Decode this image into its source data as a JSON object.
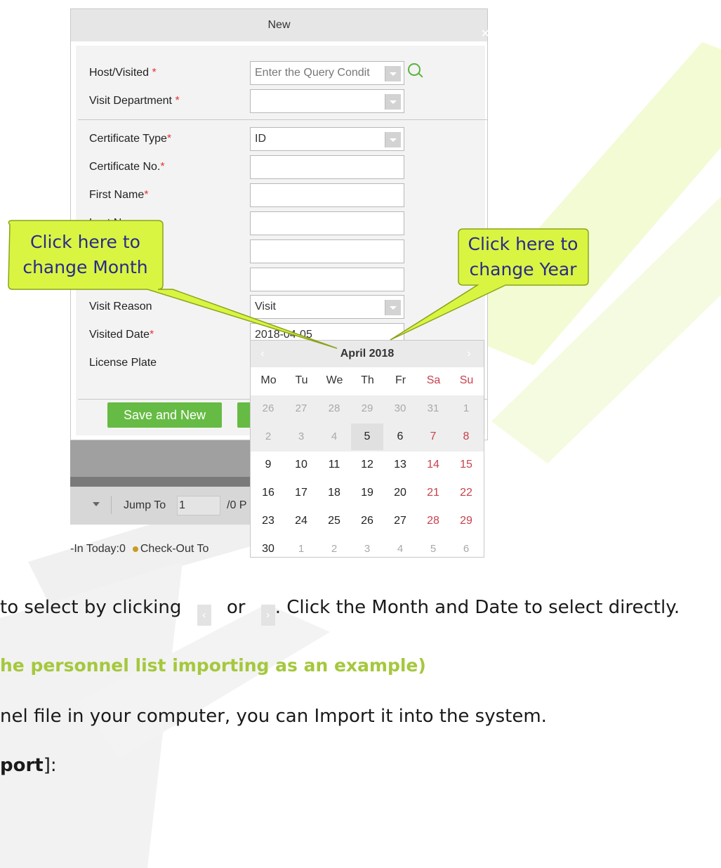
{
  "dialog": {
    "title": "New",
    "close_icon": "close-icon",
    "fields": [
      {
        "label": "Host/Visited",
        "required": true,
        "value": "Enter the Query Condit",
        "type": "combo-search"
      },
      {
        "label": "Visit Department",
        "required": true,
        "value": "",
        "type": "select"
      },
      {
        "label": "Certificate Type",
        "required": true,
        "value": "ID",
        "type": "select"
      },
      {
        "label": "Certificate No.",
        "required": true,
        "value": "",
        "type": "text"
      },
      {
        "label": "First Name",
        "required": true,
        "value": "",
        "type": "text"
      },
      {
        "label": "Last Name",
        "required": false,
        "value": "",
        "type": "text"
      },
      {
        "label": "",
        "required": false,
        "value": "",
        "type": "text"
      },
      {
        "label": "",
        "required": false,
        "value": "",
        "type": "text"
      },
      {
        "label": "Visit Reason",
        "required": false,
        "value": "Visit",
        "type": "select"
      },
      {
        "label": "Visited Date",
        "required": true,
        "value": "2018-04-05",
        "type": "date"
      },
      {
        "label": "License Plate",
        "required": false,
        "value": "",
        "type": "text"
      }
    ],
    "save_new_label": "Save and New",
    "required_mark": "*"
  },
  "background_grid": {
    "jump_label": "Jump To",
    "jump_value": "1",
    "pages_text": "/0 P",
    "status_in": "-In Today:0",
    "status_out": "Check-Out To"
  },
  "calendar": {
    "title": "April 2018",
    "weekdays": [
      "Mo",
      "Tu",
      "We",
      "Th",
      "Fr",
      "Sa",
      "Su"
    ],
    "weeks": [
      [
        "26",
        "27",
        "28",
        "29",
        "30",
        "31",
        "1"
      ],
      [
        "2",
        "3",
        "4",
        "5",
        "6",
        "7",
        "8"
      ],
      [
        "9",
        "10",
        "11",
        "12",
        "13",
        "14",
        "15"
      ],
      [
        "16",
        "17",
        "18",
        "19",
        "20",
        "21",
        "22"
      ],
      [
        "23",
        "24",
        "25",
        "26",
        "27",
        "28",
        "29"
      ],
      [
        "30",
        "1",
        "2",
        "3",
        "4",
        "5",
        "6"
      ]
    ],
    "selected_day": "5",
    "weekend_color": "#c8414d"
  },
  "callouts": {
    "month": "Click here to change Month",
    "month_line1": "Click here to",
    "month_line2": "change Month",
    "year_line1": "Click here to",
    "year_line2": "change Year"
  },
  "doc": {
    "line1_a": "to select by clicking",
    "line1_or": "or",
    "line1_b": ". Click the Month and Date to select directly.",
    "heading": "he personnel list importing as an example)",
    "line3": "nel file in your computer, you can Import it into the system.",
    "line4_bold": "port",
    "line4_end": "]:"
  },
  "colors": {
    "accent_green": "#66bb44",
    "heading_green": "#a5c83d",
    "callout_fill": "#d9f542"
  }
}
